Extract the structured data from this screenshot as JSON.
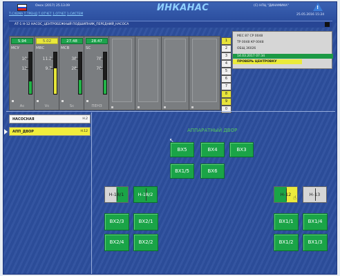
{
  "header": {
    "row1_left": "Омск (2017) 25.13.09",
    "row2_links": [
      "Т.СХЕМА",
      "Т.ТРЕНД",
      "Т.ОТЧЕТ",
      "1.ОТЧЕТ",
      "1.СИСТЕМ"
    ],
    "logo": "ИНКАНАС",
    "row1_right": "(С) НПЦ \"ДИНАМИКА\"",
    "datetime": "25.05.2016 15:24",
    "flag_colors": [
      "#ffffff",
      "#1f4fd8",
      "#d8241f"
    ],
    "warning_icon": "warning-triangle-icon"
  },
  "title": "АТ-1 Н-12 НАСОС_ЦЕНТРОБЕЖНЫЙ ПОДШИПНИК_ПЕРЕДНИЙ_НАСОСА",
  "channels": [
    {
      "value": "5.94",
      "label": "МСУ",
      "n1": "10",
      "n2": "12",
      "level": 0.3,
      "bottom": "Ас",
      "highlight": false
    },
    {
      "value": "5.02",
      "label": "МВС",
      "n1": "11.2",
      "n2": "9.7",
      "level": 0.62,
      "bottom": "Vc",
      "highlight": true
    },
    {
      "value": "27.48",
      "label": "МСВ",
      "n1": "38",
      "n2": "28",
      "level": 0.33,
      "bottom": "Sc",
      "highlight": false
    },
    {
      "value": "28.47",
      "label": "SC",
      "n1": "78",
      "n2": "70",
      "level": 0.34,
      "bottom": "ПЕНЗ",
      "highlight": false
    }
  ],
  "numbers": [
    "1",
    "2",
    "3",
    "4",
    "5",
    "6",
    "7",
    "8",
    "9",
    "0"
  ],
  "numbers_highlighted": [
    "1",
    "8",
    "9"
  ],
  "info": {
    "line1": "МЕС 87   СР 0048",
    "line2": "ТР 0048  КР 0048",
    "line3": "ОБЩ 36026",
    "msg1": "14.03.2017 07:34",
    "msg2": "ПРОВЕРЬ ЦЕНТРОВКУ"
  },
  "left_list": [
    {
      "name": "НАСОСНАЯ",
      "code": "Н.2",
      "selected": false
    },
    {
      "name": "АПП_ДВОР",
      "code": "Н.12",
      "selected": true
    }
  ],
  "schematic": {
    "title": "АППАРАТНЫЙ ДВОР",
    "top_buttons": [
      "ВХ5",
      "ВХ4",
      "ВХ3"
    ],
    "mid_buttons": [
      "ВХ1/5",
      "ВХ6"
    ],
    "left_valves": [
      "Н-18/1",
      "Н-18/2"
    ],
    "right_valves": [
      "Н-12",
      "Н-13"
    ],
    "left_grid": [
      "ВХ2/3",
      "ВХ2/1",
      "ВХ2/4",
      "ВХ2/2"
    ],
    "right_grid": [
      "ВХ1/1",
      "ВХ1/4",
      "ВХ1/2",
      "ВХ1/3"
    ]
  }
}
